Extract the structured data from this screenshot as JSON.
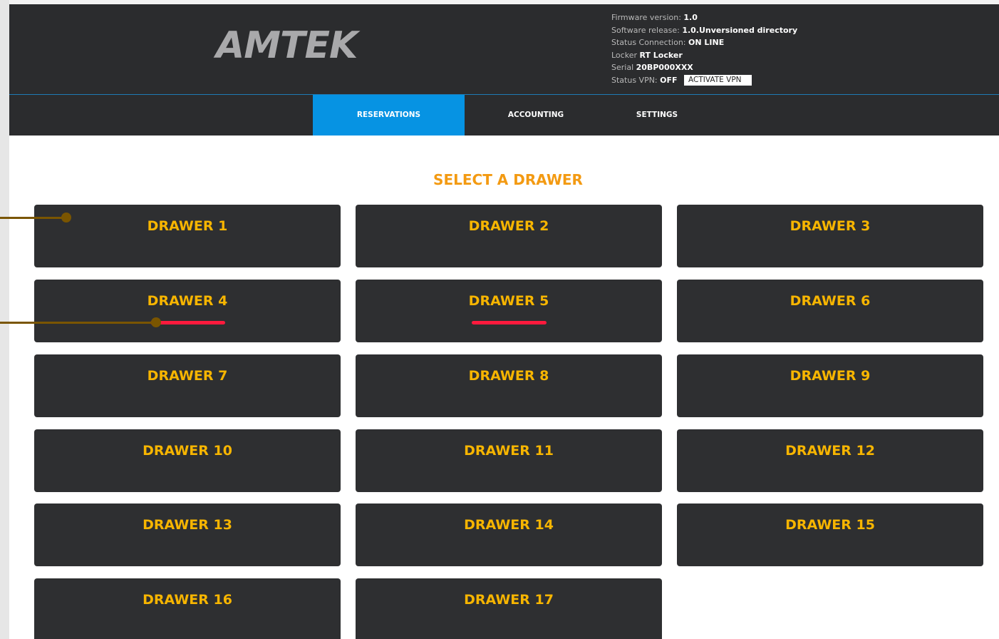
{
  "header": {
    "logo": "AMTEK",
    "firmware_label": "Firmware version: ",
    "firmware_value": "1.0",
    "software_label": "Software release: ",
    "software_value": "1.0.Unversioned directory",
    "status_conn_label": "Status Connection: ",
    "status_conn_value": "ON LINE",
    "locker_label": "Locker ",
    "locker_value": "RT Locker",
    "serial_label": "Serial ",
    "serial_value": "20BP000XXX",
    "vpn_label": "Status VPN: ",
    "vpn_value": "OFF",
    "vpn_button": "ACTIVATE VPN"
  },
  "nav": {
    "tabs": [
      {
        "label": "RESERVATIONS",
        "active": true
      },
      {
        "label": "ACCOUNTING",
        "active": false
      },
      {
        "label": "SETTINGS",
        "active": false
      }
    ]
  },
  "main": {
    "title": "SELECT A DRAWER",
    "drawers": [
      {
        "label": "DRAWER 1"
      },
      {
        "label": "DRAWER 2"
      },
      {
        "label": "DRAWER 3"
      },
      {
        "label": "DRAWER 4",
        "alert": true
      },
      {
        "label": "DRAWER 5",
        "alert": true
      },
      {
        "label": "DRAWER 6"
      },
      {
        "label": "DRAWER 7"
      },
      {
        "label": "DRAWER 8"
      },
      {
        "label": "DRAWER 9"
      },
      {
        "label": "DRAWER 10"
      },
      {
        "label": "DRAWER 11"
      },
      {
        "label": "DRAWER 12"
      },
      {
        "label": "DRAWER 13"
      },
      {
        "label": "DRAWER 14"
      },
      {
        "label": "DRAWER 15"
      },
      {
        "label": "DRAWER 16"
      },
      {
        "label": "DRAWER 17"
      }
    ]
  },
  "colors": {
    "header_bg": "#2b2c2e",
    "active_tab": "#0693e3",
    "title": "#f39a12",
    "drawer_bg": "#2e2f31",
    "drawer_label": "#f7b500",
    "alert_bar": "#ff1a3d"
  }
}
